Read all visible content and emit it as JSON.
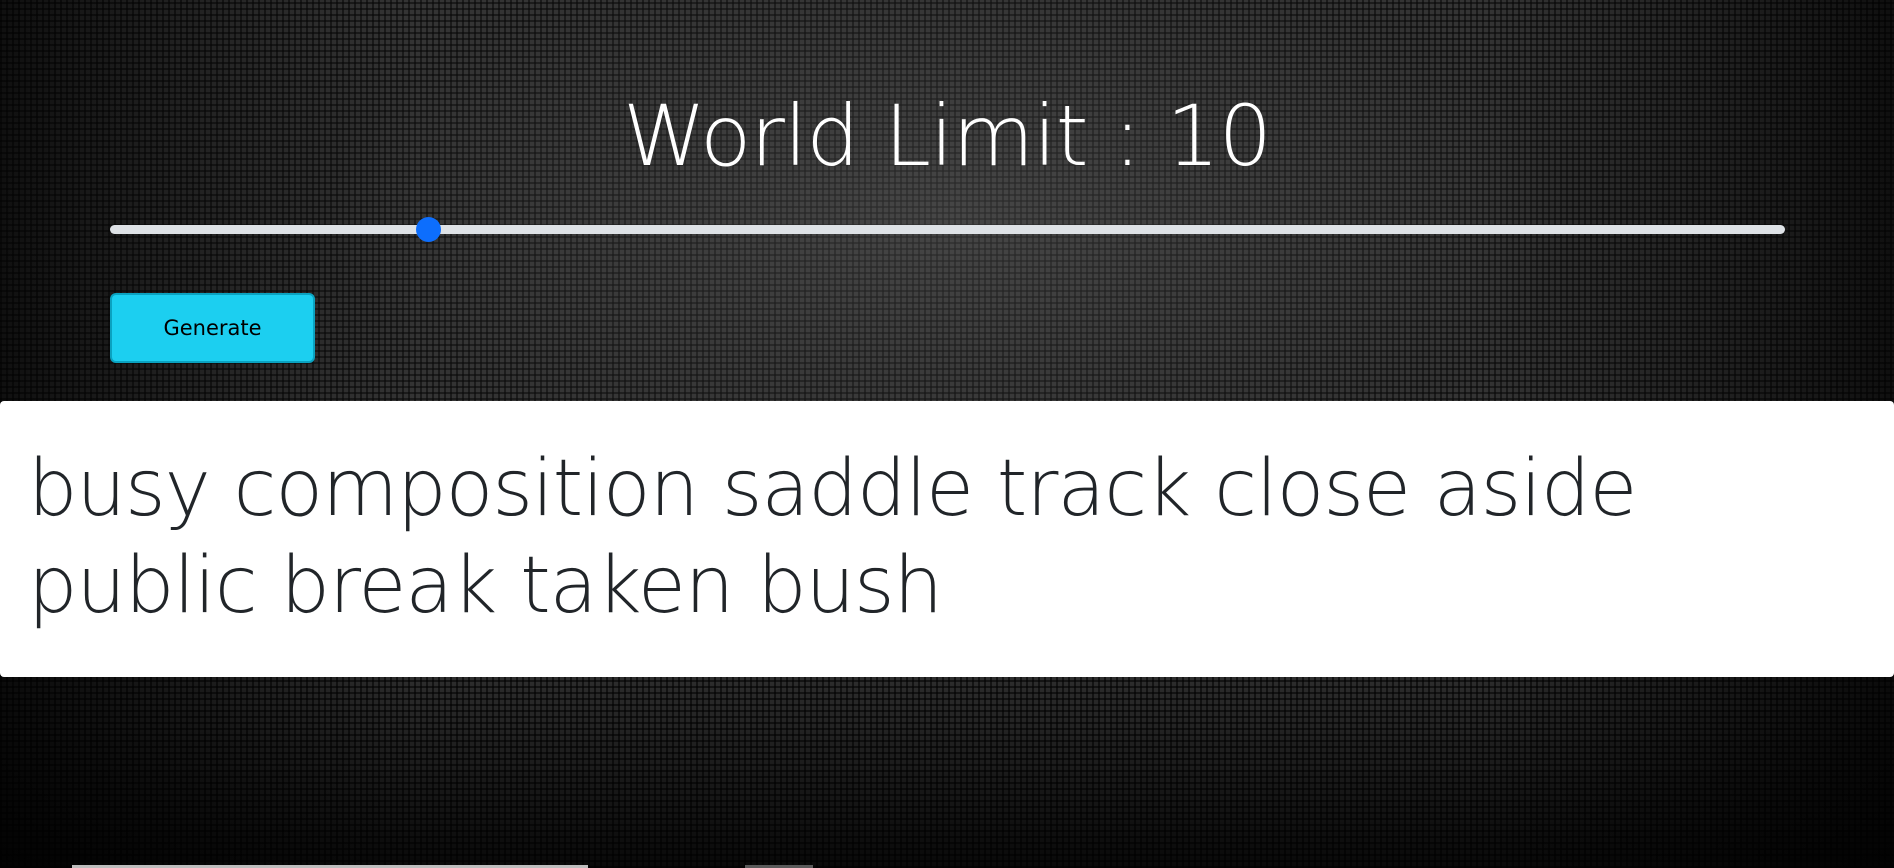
{
  "header": {
    "title": "World Limit : 10"
  },
  "slider": {
    "value": 10,
    "min": 1,
    "max": 50,
    "fill_fraction": 0.19,
    "thumb_color": "#0d6efd",
    "track_color": "#dee2e6"
  },
  "actions": {
    "generate_label": "Generate",
    "generate_color": "#1ccff0"
  },
  "output": {
    "text": "busy composition saddle track close aside public break taken bush"
  }
}
